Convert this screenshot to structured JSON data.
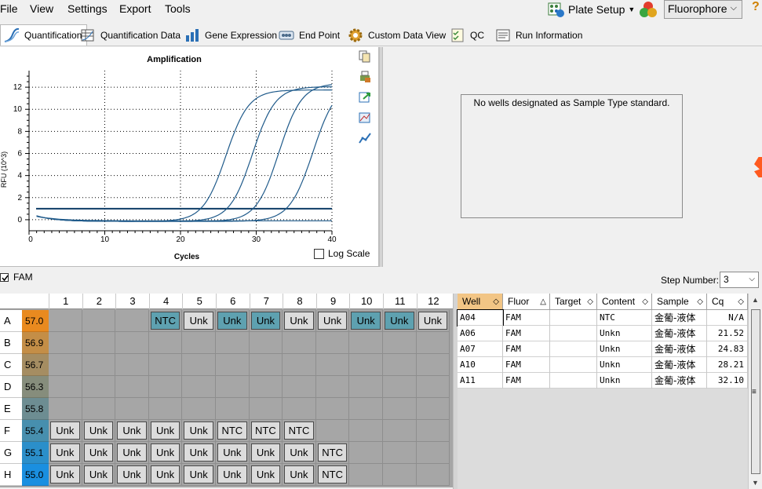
{
  "menu": {
    "file": "File",
    "view": "View",
    "settings": "Settings",
    "export": "Export",
    "tools": "Tools"
  },
  "toolbar": {
    "plate_setup": "Plate Setup",
    "fluorophore": "Fluorophore"
  },
  "tabs": [
    {
      "label": "Quantification",
      "active": true
    },
    {
      "label": "Quantification Data"
    },
    {
      "label": "Gene Expression"
    },
    {
      "label": "End Point"
    },
    {
      "label": "Custom Data View"
    },
    {
      "label": "QC"
    },
    {
      "label": "Run Information"
    }
  ],
  "standard_message": "No wells designated as Sample Type standard.",
  "log_scale_label": "Log Scale",
  "fam_label": "FAM",
  "step_label": "Step Number:",
  "step_value": "3",
  "chart_data": {
    "type": "line",
    "title": "Amplification",
    "xlabel": "Cycles",
    "ylabel": "RFU (10^3)",
    "xlim": [
      0,
      40
    ],
    "ylim": [
      -1,
      13.5
    ],
    "xticks": [
      10,
      20,
      30,
      40
    ],
    "yticks": [
      0,
      2,
      4,
      6,
      8,
      10,
      12
    ],
    "grid": true,
    "threshold": 1.0,
    "line_color": "#1f5a8a",
    "series": [
      {
        "well": "A06",
        "midpoint": 26.0,
        "plateau": 11.9,
        "steepness": 1.5
      },
      {
        "well": "A07",
        "midpoint": 29.5,
        "plateau": 12.2,
        "steepness": 1.5
      },
      {
        "well": "A10",
        "midpoint": 33.0,
        "plateau": 12.5,
        "steepness": 1.5
      },
      {
        "well": "A11",
        "midpoint": 37.5,
        "plateau": 12.6,
        "steepness": 1.55
      }
    ]
  },
  "plate": {
    "columns": [
      "1",
      "2",
      "3",
      "4",
      "5",
      "6",
      "7",
      "8",
      "9",
      "10",
      "11",
      "12"
    ],
    "rows": [
      {
        "label": "A",
        "temp": "57.0",
        "temp_color": "#e98a1f",
        "wells": [
          "",
          "",
          "",
          "NTC",
          "Unk",
          "Unk",
          "Unk",
          "Unk",
          "Unk",
          "Unk",
          "Unk",
          "Unk"
        ],
        "selected": [
          4,
          6,
          7,
          10,
          11
        ]
      },
      {
        "label": "B",
        "temp": "56.9",
        "temp_color": "#c48e47",
        "wells": [
          "",
          "",
          "",
          "",
          "",
          "",
          "",
          "",
          "",
          "",
          "",
          ""
        ],
        "selected": []
      },
      {
        "label": "C",
        "temp": "56.7",
        "temp_color": "#a58d62",
        "wells": [
          "",
          "",
          "",
          "",
          "",
          "",
          "",
          "",
          "",
          "",
          "",
          ""
        ],
        "selected": []
      },
      {
        "label": "D",
        "temp": "56.3",
        "temp_color": "#868d7c",
        "wells": [
          "",
          "",
          "",
          "",
          "",
          "",
          "",
          "",
          "",
          "",
          "",
          ""
        ],
        "selected": []
      },
      {
        "label": "E",
        "temp": "55.8",
        "temp_color": "#6d8d92",
        "wells": [
          "",
          "",
          "",
          "",
          "",
          "",
          "",
          "",
          "",
          "",
          "",
          ""
        ],
        "selected": []
      },
      {
        "label": "F",
        "temp": "55.4",
        "temp_color": "#478fae",
        "wells": [
          "Unk",
          "Unk",
          "Unk",
          "Unk",
          "Unk",
          "NTC",
          "NTC",
          "NTC",
          "",
          "",
          "",
          ""
        ],
        "selected": []
      },
      {
        "label": "G",
        "temp": "55.1",
        "temp_color": "#2b8fca",
        "wells": [
          "Unk",
          "Unk",
          "Unk",
          "Unk",
          "Unk",
          "Unk",
          "Unk",
          "Unk",
          "NTC",
          "",
          "",
          ""
        ],
        "selected": []
      },
      {
        "label": "H",
        "temp": "55.0",
        "temp_color": "#1a8fe0",
        "wells": [
          "Unk",
          "Unk",
          "Unk",
          "Unk",
          "Unk",
          "Unk",
          "Unk",
          "Unk",
          "NTC",
          "",
          "",
          ""
        ],
        "selected": []
      }
    ]
  },
  "results": {
    "headers": [
      "Well",
      "Fluor",
      "Target",
      "Content",
      "Sample",
      "Cq"
    ],
    "rows": [
      {
        "well": "A04",
        "fluor": "FAM",
        "target": "",
        "content": "NTC",
        "sample": "金葡-液体",
        "cq": "N/A"
      },
      {
        "well": "A06",
        "fluor": "FAM",
        "target": "",
        "content": "Unkn",
        "sample": "金葡-液体",
        "cq": "21.52"
      },
      {
        "well": "A07",
        "fluor": "FAM",
        "target": "",
        "content": "Unkn",
        "sample": "金葡-液体",
        "cq": "24.83"
      },
      {
        "well": "A10",
        "fluor": "FAM",
        "target": "",
        "content": "Unkn",
        "sample": "金葡-液体",
        "cq": "28.21"
      },
      {
        "well": "A11",
        "fluor": "FAM",
        "target": "",
        "content": "Unkn",
        "sample": "金葡-液体",
        "cq": "32.10"
      }
    ]
  }
}
